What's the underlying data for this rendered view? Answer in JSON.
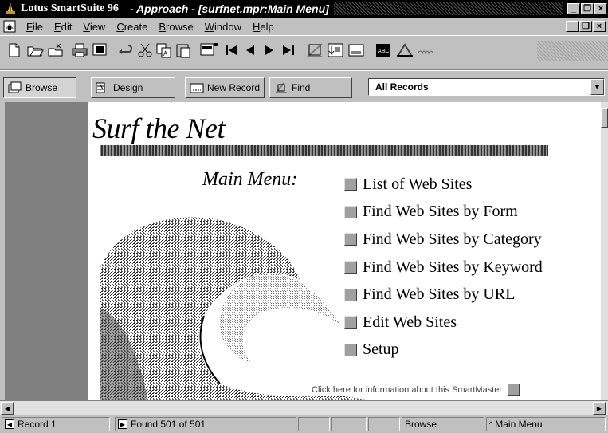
{
  "window": {
    "app_title": "Lotus SmartSuite 96",
    "doc_title": "- Approach - [surfnet.mpr:Main Menu]",
    "controls": {
      "minimize": "_",
      "maximize": "❐",
      "close": "×"
    }
  },
  "menubar": {
    "items": [
      {
        "label": "File",
        "underline": "F",
        "rest": "ile"
      },
      {
        "label": "Edit",
        "underline": "E",
        "rest": "dit"
      },
      {
        "label": "View",
        "underline": "V",
        "rest": "iew"
      },
      {
        "label": "Create",
        "underline": "C",
        "rest": "reate"
      },
      {
        "label": "Browse",
        "underline": "B",
        "rest": "rowse"
      },
      {
        "label": "Window",
        "underline": "W",
        "rest": "indow"
      },
      {
        "label": "Help",
        "underline": "H",
        "rest": "elp"
      }
    ],
    "doc_controls": {
      "minimize": "_",
      "restore": "❐",
      "close": "×"
    }
  },
  "toolbar": {
    "icons": [
      "new-file-icon",
      "open-folder-icon",
      "open-icon",
      "print-icon",
      "preview-icon",
      "undo-icon",
      "cut-icon",
      "copy-icon",
      "paste-icon",
      "dropdown-icon",
      "first-record-icon",
      "previous-record-icon",
      "next-record-icon",
      "last-record-icon",
      "find-icon",
      "sort-icon",
      "form-icon",
      "spell-check-icon",
      "smarticons-icon",
      "draw-icon"
    ]
  },
  "actionbar": {
    "browse_label": "Browse",
    "design_label": "Design",
    "new_record_label": "New Record",
    "find_label": "Find",
    "records_selected": "All Records"
  },
  "form": {
    "title": "Surf the Net",
    "menu_label": "Main Menu:",
    "options": [
      "List of Web Sites",
      "Find Web Sites by Form",
      "Find Web Sites by Category",
      "Find Web Sites by Keyword",
      "Find Web Sites by URL",
      "Edit Web Sites",
      "Setup"
    ],
    "info_link": "Click here for information about this SmartMaster"
  },
  "statusbar": {
    "record": "Record 1",
    "found": "Found 501 of 501",
    "mode": "Browse",
    "view": "Main Menu"
  }
}
